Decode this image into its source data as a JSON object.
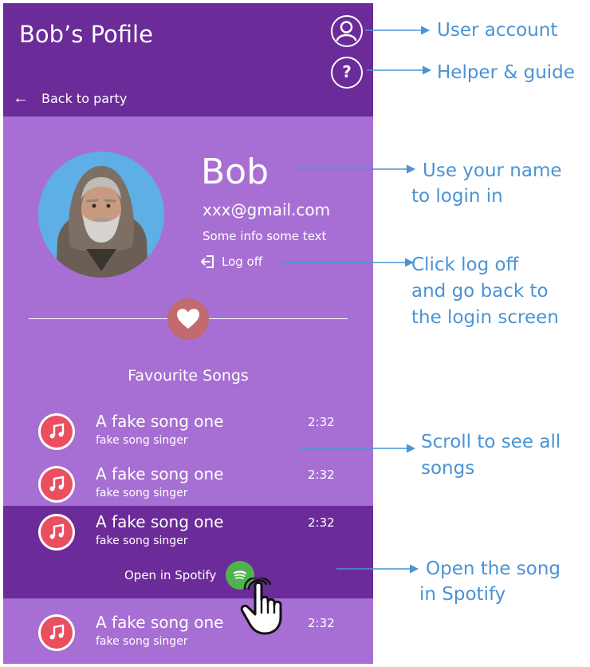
{
  "header": {
    "title": "Bob’s Pofile",
    "back_label": "Back to party",
    "help_label": "?"
  },
  "profile": {
    "name": "Bob",
    "email": "xxx@gmail.com",
    "info": "Some info some text",
    "logoff_label": "Log off"
  },
  "favourites": {
    "title": "Favourite Songs",
    "songs": [
      {
        "title": "A fake song one",
        "artist": "fake song singer",
        "duration": "2:32"
      },
      {
        "title": "A fake song one",
        "artist": "fake song singer",
        "duration": "2:32"
      },
      {
        "title": "A fake song one",
        "artist": "fake song singer",
        "duration": "2:32"
      },
      {
        "title": "A fake song one",
        "artist": "fake song singer",
        "duration": "2:32"
      }
    ],
    "spotify_label": "Open in Spotify"
  },
  "annotations": {
    "user_account": "User account",
    "helper": "Helper & guide",
    "name_line1": "Use your name",
    "name_line2": "to login in",
    "logoff_line1": "Click log off",
    "logoff_line2": "and go back to",
    "logoff_line3": "the login screen",
    "scroll_line1": "Scroll to see all",
    "scroll_line2": "songs",
    "spotify_line1": "Open the song",
    "spotify_line2": "in Spotify"
  },
  "colors": {
    "panel": "#a76fd3",
    "header": "#6b2b98",
    "accent_heart": "#c16a6f",
    "song_icon": "#e94f5e",
    "spotify": "#50b24e",
    "annotation": "#4a93d6"
  },
  "icons": {
    "user": "user-circle-icon",
    "help": "help-circle-icon",
    "back": "arrow-left-icon",
    "logoff": "logout-icon",
    "heart": "heart-icon",
    "song": "music-note-icon",
    "spotify": "spotify-icon",
    "cursor": "hand-pointer-icon"
  }
}
